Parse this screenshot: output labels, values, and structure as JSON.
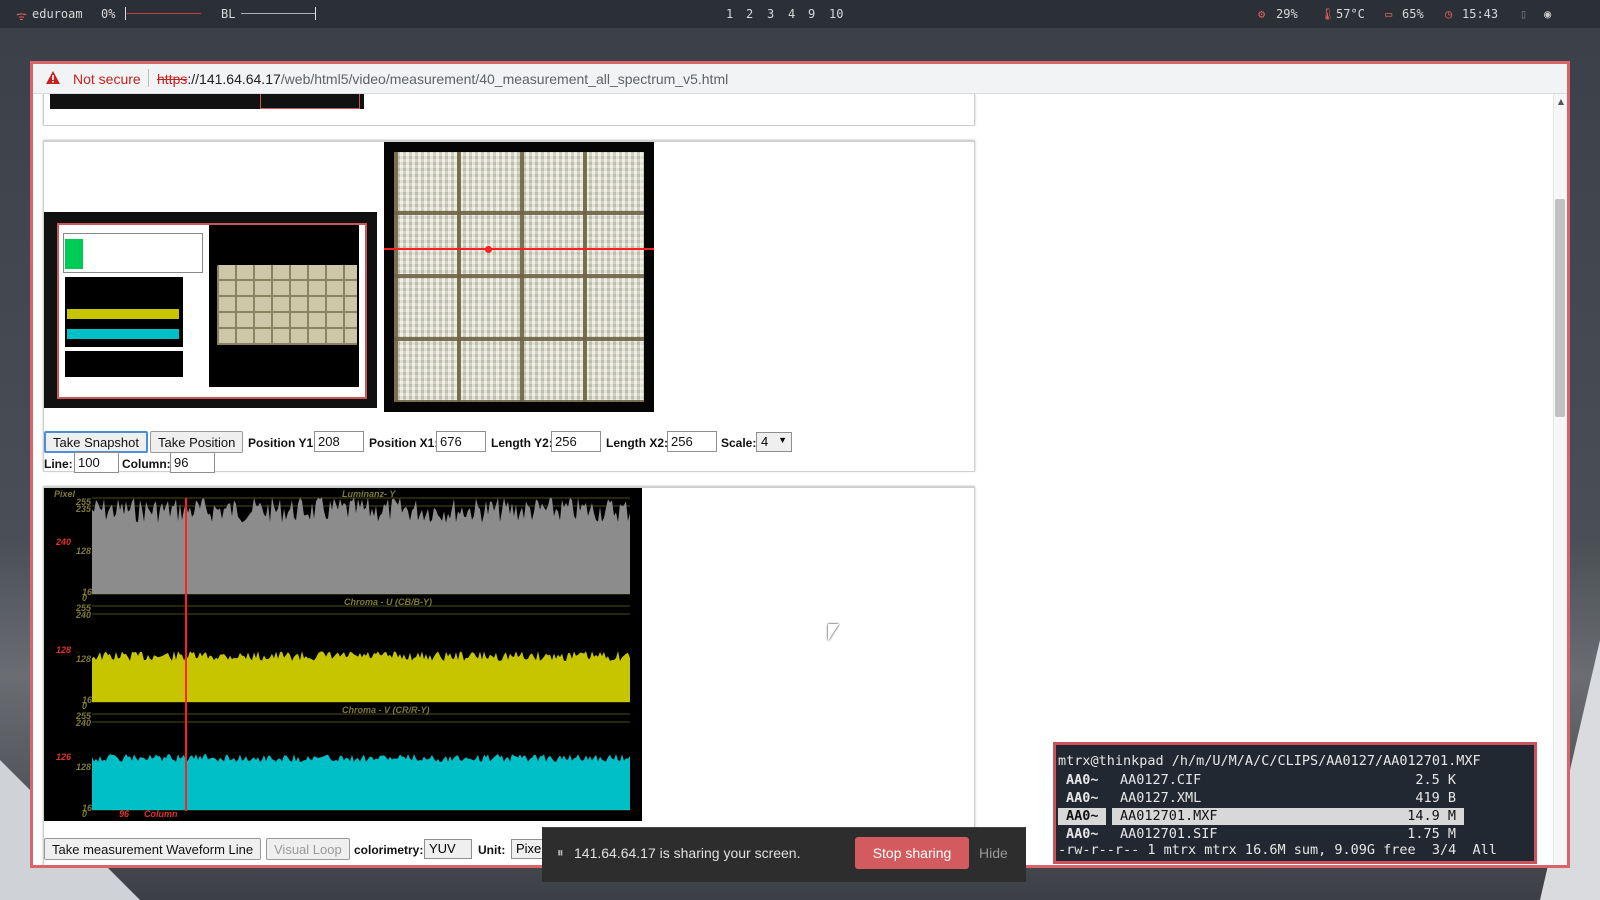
{
  "statusbar": {
    "wifi": "eduroam",
    "volume": "0%",
    "backlight_label": "BL",
    "workspaces": [
      "1",
      "2",
      "3",
      "4",
      "9",
      "10"
    ],
    "cpu": "29%",
    "temp": "57°C",
    "battery": "65%",
    "time": "15:43"
  },
  "browser": {
    "security": "Not secure",
    "url_scheme": "https",
    "url_host": "://141.64.64.17",
    "url_path": "/web/html5/video/measurement/40_measurement_all_spectrum_v5.html"
  },
  "controls": {
    "take_snapshot": "Take Snapshot",
    "take_position": "Take Position",
    "pos_y1_label": "Position Y1:",
    "pos_y1": "208",
    "pos_x1_label": "Position X1:",
    "pos_x1": "676",
    "len_y2_label": "Length Y2:",
    "len_y2": "256",
    "len_x2_label": "Length X2:",
    "len_x2": "256",
    "scale_label": "Scale:",
    "scale": "4",
    "line_label": "Line:",
    "line": "100",
    "column_label": "Column:",
    "column": "96"
  },
  "waveform": {
    "pixel_label": "Pixel",
    "luma_title": "Luminanz- Y",
    "chroma_u_title": "Chroma - U (CB/B-Y)",
    "chroma_v_title": "Chroma - V (CR/R-Y)",
    "luma_ticks": [
      "255",
      "235",
      "128",
      "16",
      "0"
    ],
    "luma_red": "240",
    "u_ticks": [
      "255",
      "240",
      "128",
      "16",
      "0"
    ],
    "u_red": "128",
    "v_ticks": [
      "255",
      "240",
      "128",
      "16",
      "0"
    ],
    "v_red": "126",
    "column_value": "96",
    "column_label": "Column",
    "colors": {
      "luma": "#8c8c8c",
      "u": "#c6c500",
      "v": "#00bfc6",
      "marker": "#ff2020"
    }
  },
  "bottom_controls": {
    "take_measurement": "Take measurement Waveform Line",
    "visual_loop": "Visual Loop",
    "colorimetry_label": "colorimetry:",
    "colorimetry": "YUV",
    "unit_label": "Unit:",
    "unit": "Pixel"
  },
  "terminal": {
    "title": "mtrx@thinkpad /h/m/U/M/A/C/CLIPS/AA0127/AA012701.MXF",
    "files": [
      {
        "tag": "AA0~",
        "name": "AA0127.CIF",
        "size": "2.5 K"
      },
      {
        "tag": "AA0~",
        "name": "AA0127.XML",
        "size": "419 B"
      },
      {
        "tag": "AA0~",
        "name": "AA012701.MXF",
        "size": "14.9 M"
      },
      {
        "tag": "AA0~",
        "name": "AA012701.SIF",
        "size": "1.75 M"
      }
    ],
    "status": "-rw-r--r-- 1 mtrx mtrx 16.6M sum, 9.09G free  3/4  All"
  },
  "sharebar": {
    "message": "141.64.64.17 is sharing your screen.",
    "stop": "Stop sharing",
    "hide": "Hide"
  }
}
